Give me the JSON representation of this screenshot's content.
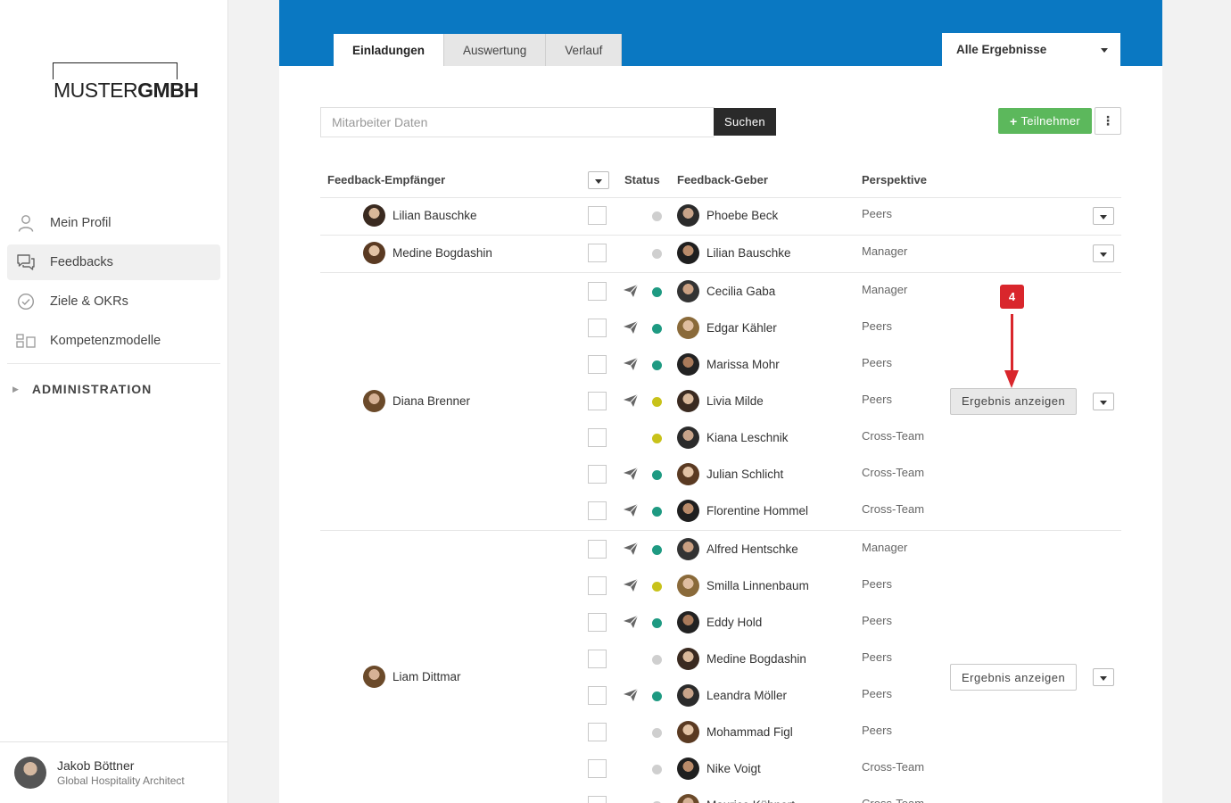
{
  "brand": {
    "logo_light": "MUSTER",
    "logo_bold": "GMBH"
  },
  "nav": {
    "items": [
      {
        "label": "Mein Profil",
        "icon": "person-icon"
      },
      {
        "label": "Feedbacks",
        "icon": "chat-icon",
        "active": true
      },
      {
        "label": "Ziele & OKRs",
        "icon": "check-circle-icon"
      },
      {
        "label": "Kompetenzmodelle",
        "icon": "grid-icon"
      }
    ],
    "admin_label": "ADMINISTRATION"
  },
  "user": {
    "name": "Jakob Böttner",
    "role": "Global Hospitality Architect"
  },
  "tabs": [
    "Einladungen",
    "Auswertung",
    "Verlauf"
  ],
  "filter": {
    "selected": "Alle Ergebnisse"
  },
  "search": {
    "placeholder": "Mitarbeiter Daten",
    "button": "Suchen"
  },
  "actions": {
    "add_label": "Teilnehmer"
  },
  "table": {
    "headers": {
      "recipient": "Feedback-Empfänger",
      "status": "Status",
      "giver": "Feedback-Geber",
      "perspective": "Perspektive"
    },
    "result_label": "Ergebnis anzeigen",
    "groups": [
      {
        "recipient": "Lilian Bauschke",
        "givers": [
          {
            "name": "Phoebe Beck",
            "perspective": "Peers",
            "sent": false,
            "status": "grey"
          }
        ]
      },
      {
        "recipient": "Medine Bogdashin",
        "givers": [
          {
            "name": "Lilian Bauschke",
            "perspective": "Manager",
            "sent": false,
            "status": "grey"
          }
        ]
      },
      {
        "recipient": "Diana Brenner",
        "givers": [
          {
            "name": "Cecilia Gaba",
            "perspective": "Manager",
            "sent": true,
            "status": "green"
          },
          {
            "name": "Edgar Kähler",
            "perspective": "Peers",
            "sent": true,
            "status": "green"
          },
          {
            "name": "Marissa Mohr",
            "perspective": "Peers",
            "sent": true,
            "status": "green"
          },
          {
            "name": "Livia Milde",
            "perspective": "Peers",
            "sent": true,
            "status": "yellow"
          },
          {
            "name": "Kiana Leschnik",
            "perspective": "Cross-Team",
            "sent": false,
            "status": "yellow"
          },
          {
            "name": "Julian Schlicht",
            "perspective": "Cross-Team",
            "sent": true,
            "status": "green"
          },
          {
            "name": "Florentine Hommel",
            "perspective": "Cross-Team",
            "sent": true,
            "status": "green"
          }
        ]
      },
      {
        "recipient": "Liam Dittmar",
        "givers": [
          {
            "name": "Alfred Hentschke",
            "perspective": "Manager",
            "sent": true,
            "status": "green"
          },
          {
            "name": "Smilla Linnenbaum",
            "perspective": "Peers",
            "sent": true,
            "status": "yellow"
          },
          {
            "name": "Eddy Hold",
            "perspective": "Peers",
            "sent": true,
            "status": "green"
          },
          {
            "name": "Medine Bogdashin",
            "perspective": "Peers",
            "sent": false,
            "status": "grey"
          },
          {
            "name": "Leandra Möller",
            "perspective": "Peers",
            "sent": true,
            "status": "green"
          },
          {
            "name": "Mohammad Figl",
            "perspective": "Peers",
            "sent": false,
            "status": "grey"
          },
          {
            "name": "Nike Voigt",
            "perspective": "Cross-Team",
            "sent": false,
            "status": "grey"
          },
          {
            "name": "Maurice Kühnert",
            "perspective": "Cross-Team",
            "sent": false,
            "status": "grey"
          }
        ]
      }
    ]
  },
  "annotation": {
    "step": "4"
  },
  "colors": {
    "banner": "#0a78c2",
    "add_button": "#5cb85c",
    "status_green": "#1e9a82",
    "status_yellow": "#c8c21a",
    "status_grey": "#cfcfcf",
    "marker": "#d9262c"
  }
}
